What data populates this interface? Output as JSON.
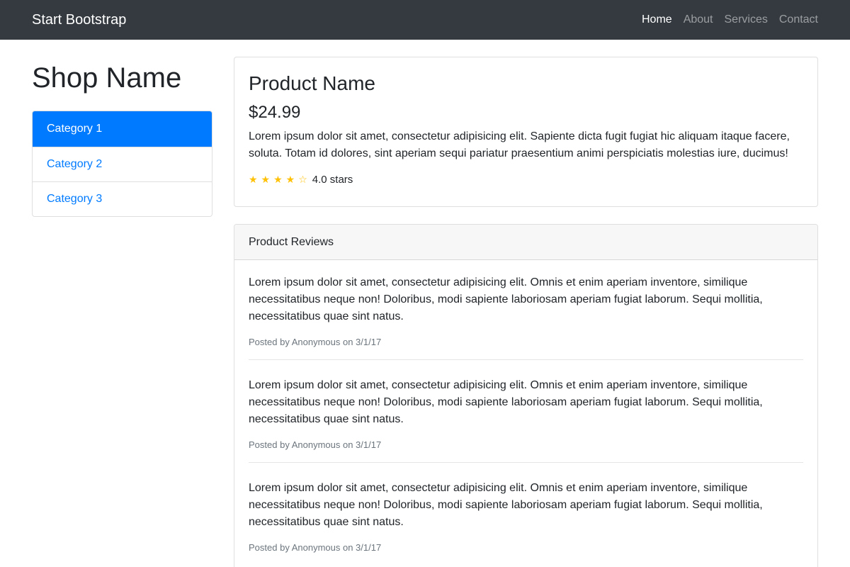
{
  "navbar": {
    "brand": "Start Bootstrap",
    "links": [
      {
        "label": "Home",
        "active": true
      },
      {
        "label": "About",
        "active": false
      },
      {
        "label": "Services",
        "active": false
      },
      {
        "label": "Contact",
        "active": false
      }
    ]
  },
  "sidebar": {
    "shop_name": "Shop Name",
    "categories": [
      {
        "label": "Category 1",
        "active": true
      },
      {
        "label": "Category 2",
        "active": false
      },
      {
        "label": "Category 3",
        "active": false
      }
    ]
  },
  "product": {
    "name": "Product Name",
    "price": "$24.99",
    "description": "Lorem ipsum dolor sit amet, consectetur adipisicing elit. Sapiente dicta fugit fugiat hic aliquam itaque facere, soluta. Totam id dolores, sint aperiam sequi pariatur praesentium animi perspiciatis molestias iure, ducimus!",
    "rating": 4,
    "rating_max": 5,
    "rating_label": "4.0 stars"
  },
  "reviews": {
    "header": "Product Reviews",
    "items": [
      {
        "text": "Lorem ipsum dolor sit amet, consectetur adipisicing elit. Omnis et enim aperiam inventore, similique necessitatibus neque non! Doloribus, modi sapiente laboriosam aperiam fugiat laborum. Sequi mollitia, necessitatibus quae sint natus.",
        "meta": "Posted by Anonymous on 3/1/17"
      },
      {
        "text": "Lorem ipsum dolor sit amet, consectetur adipisicing elit. Omnis et enim aperiam inventore, similique necessitatibus neque non! Doloribus, modi sapiente laboriosam aperiam fugiat laborum. Sequi mollitia, necessitatibus quae sint natus.",
        "meta": "Posted by Anonymous on 3/1/17"
      },
      {
        "text": "Lorem ipsum dolor sit amet, consectetur adipisicing elit. Omnis et enim aperiam inventore, similique necessitatibus neque non! Doloribus, modi sapiente laboriosam aperiam fugiat laborum. Sequi mollitia, necessitatibus quae sint natus.",
        "meta": "Posted by Anonymous on 3/1/17"
      }
    ]
  },
  "colors": {
    "navbar_bg": "#343a40",
    "primary": "#007bff",
    "star": "#ffc107",
    "muted": "#6c757d"
  }
}
